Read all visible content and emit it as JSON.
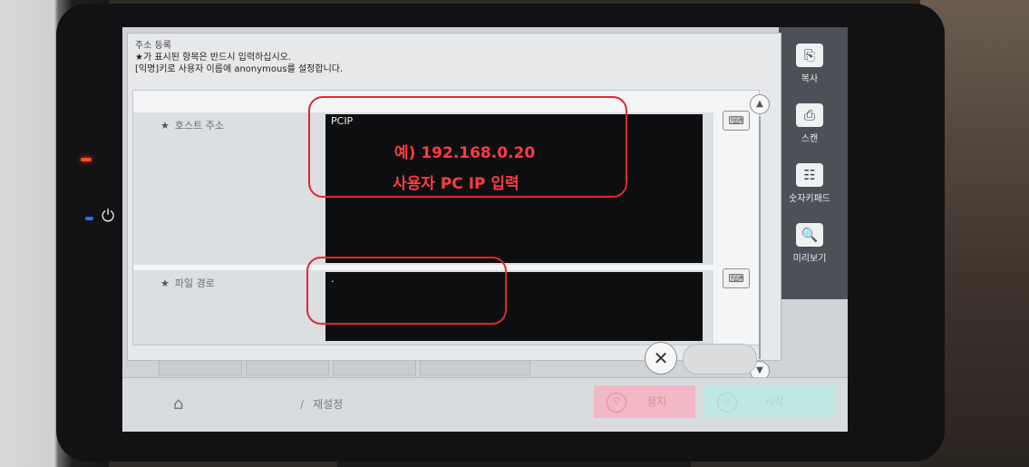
{
  "dialog": {
    "title": "주소 등록",
    "message_line1": "★가 표시된 항목은 반드시 입력하십시오.",
    "message_line2": "[익명]키로 사용자 이름에 anonymous를 설정합니다."
  },
  "form": {
    "required_mark": "★",
    "host": {
      "label": "호스트 주소",
      "value": "PCIP"
    },
    "path": {
      "label": "파일 경로",
      "value": "."
    }
  },
  "side_panel": [
    {
      "label": "복사",
      "icon": "copy-icon"
    },
    {
      "label": "스캔",
      "icon": "scan-icon"
    },
    {
      "label": "숫자키패드",
      "icon": "keypad-icon"
    },
    {
      "label": "미리보기",
      "icon": "preview-icon"
    }
  ],
  "bottom": {
    "reset_label": "재설정",
    "stop_label": "정지",
    "start_label": "시작"
  },
  "annotations": {
    "ip_example": "예) 192.168.0.20",
    "ip_instruction": "사용자 PC IP 입력",
    "color": "#e3262f"
  }
}
